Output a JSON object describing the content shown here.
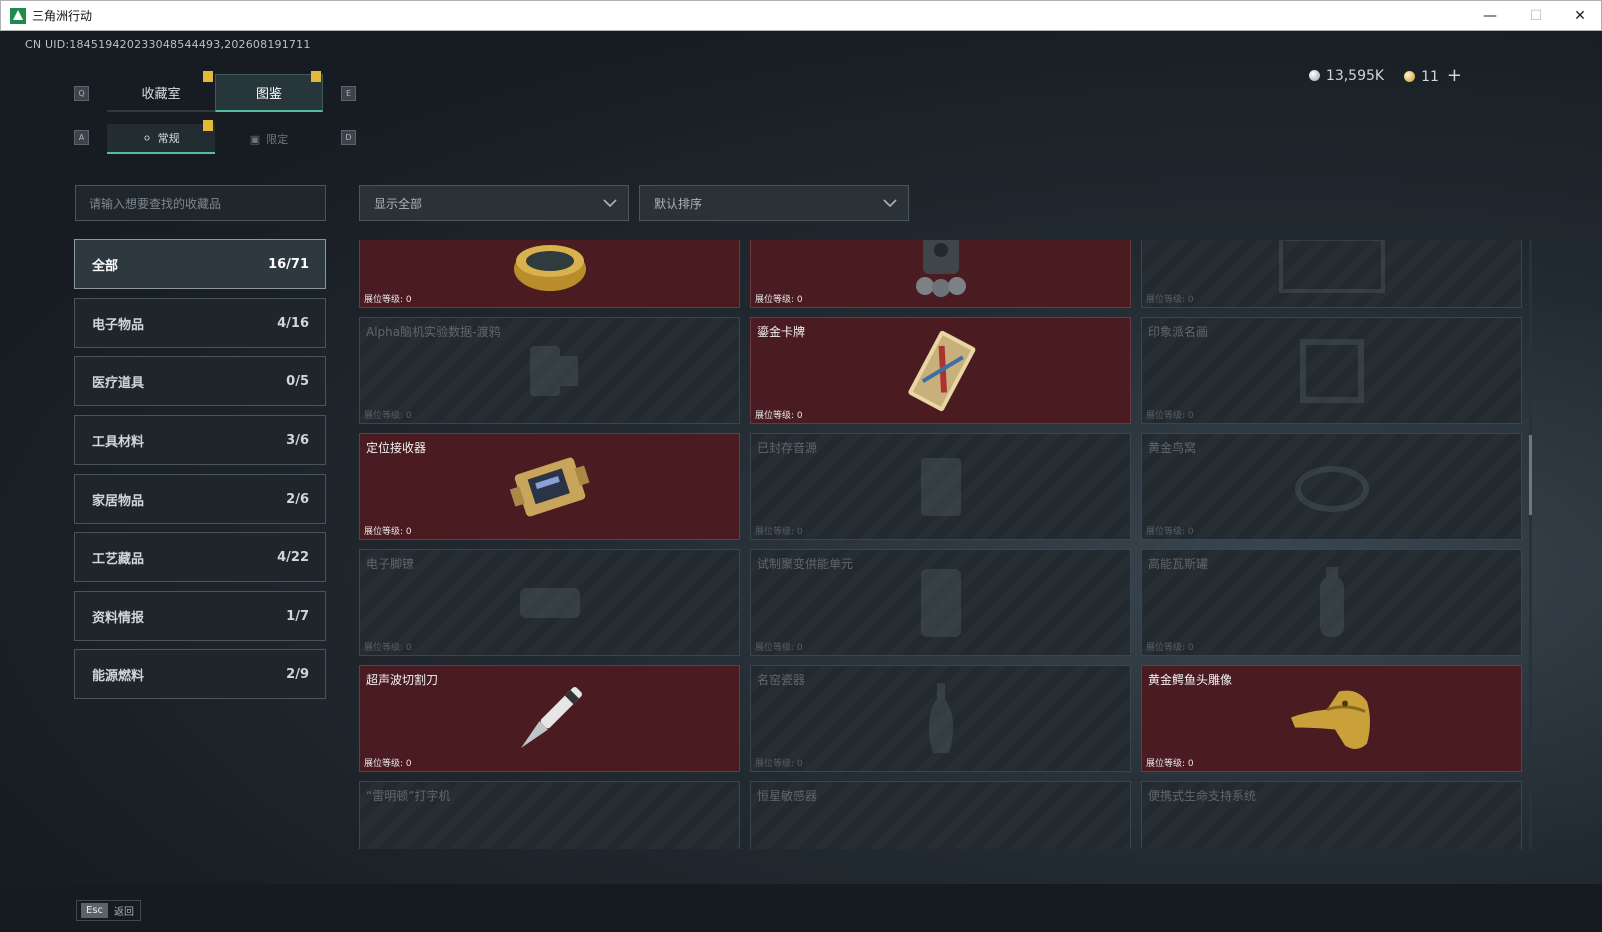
{
  "window": {
    "title": "三角洲行动"
  },
  "header": {
    "uid": "CN UID:184519420233048544493,202608191711",
    "silver": "13,595K",
    "gold": "11",
    "add": "+"
  },
  "keys": {
    "q": "Q",
    "e": "E",
    "a": "A",
    "d": "D",
    "esc": "Esc"
  },
  "tabs": [
    "收藏室",
    "图鉴"
  ],
  "subtabs": [
    "常规",
    "限定"
  ],
  "search": {
    "placeholder": "请输入想要查找的收藏品"
  },
  "filters": {
    "show": "显示全部",
    "sort": "默认排序"
  },
  "categories": [
    {
      "label": "全部",
      "count": "16/71"
    },
    {
      "label": "电子物品",
      "count": "4/16"
    },
    {
      "label": "医疗道具",
      "count": "0/5"
    },
    {
      "label": "工具材料",
      "count": "3/6"
    },
    {
      "label": "家居物品",
      "count": "2/6"
    },
    {
      "label": "工艺藏品",
      "count": "4/22"
    },
    {
      "label": "资料情报",
      "count": "1/7"
    },
    {
      "label": "能源燃料",
      "count": "2/9"
    }
  ],
  "level_label": "展位等级: 0",
  "items": [
    {
      "name": "",
      "owned": true,
      "icon": "caviar-tin-icon"
    },
    {
      "name": "",
      "owned": true,
      "icon": "robot-device-icon"
    },
    {
      "name": "",
      "owned": false,
      "icon": "frame-icon"
    },
    {
      "name": "Alpha脑机实验数据-渡鸦",
      "owned": false,
      "icon": "data-device-icon"
    },
    {
      "name": "鎏金卡牌",
      "owned": true,
      "icon": "gilded-card-icon"
    },
    {
      "name": "印象派名画",
      "owned": false,
      "icon": "painting-icon"
    },
    {
      "name": "定位接收器",
      "owned": true,
      "icon": "receiver-icon"
    },
    {
      "name": "已封存音源",
      "owned": false,
      "icon": "sealed-audio-icon"
    },
    {
      "name": "黄金鸟窝",
      "owned": false,
      "icon": "golden-nest-icon"
    },
    {
      "name": "电子脚镣",
      "owned": false,
      "icon": "ankle-monitor-icon"
    },
    {
      "name": "试制聚变供能单元",
      "owned": false,
      "icon": "fusion-cell-icon"
    },
    {
      "name": "高能瓦斯罐",
      "owned": false,
      "icon": "gas-canister-icon"
    },
    {
      "name": "超声波切割刀",
      "owned": true,
      "icon": "ultrasonic-knife-icon"
    },
    {
      "name": "名窑瓷器",
      "owned": false,
      "icon": "porcelain-vase-icon"
    },
    {
      "name": "黄金鳄鱼头雕像",
      "owned": true,
      "icon": "gold-crocodile-icon"
    },
    {
      "name": "“雷明顿”打字机",
      "owned": false,
      "icon": "typewriter-icon"
    },
    {
      "name": "恒星敏感器",
      "owned": false,
      "icon": "star-sensor-icon"
    },
    {
      "name": "便携式生命支持系统",
      "owned": false,
      "icon": "life-support-icon"
    }
  ],
  "footer": {
    "back": "返回"
  }
}
